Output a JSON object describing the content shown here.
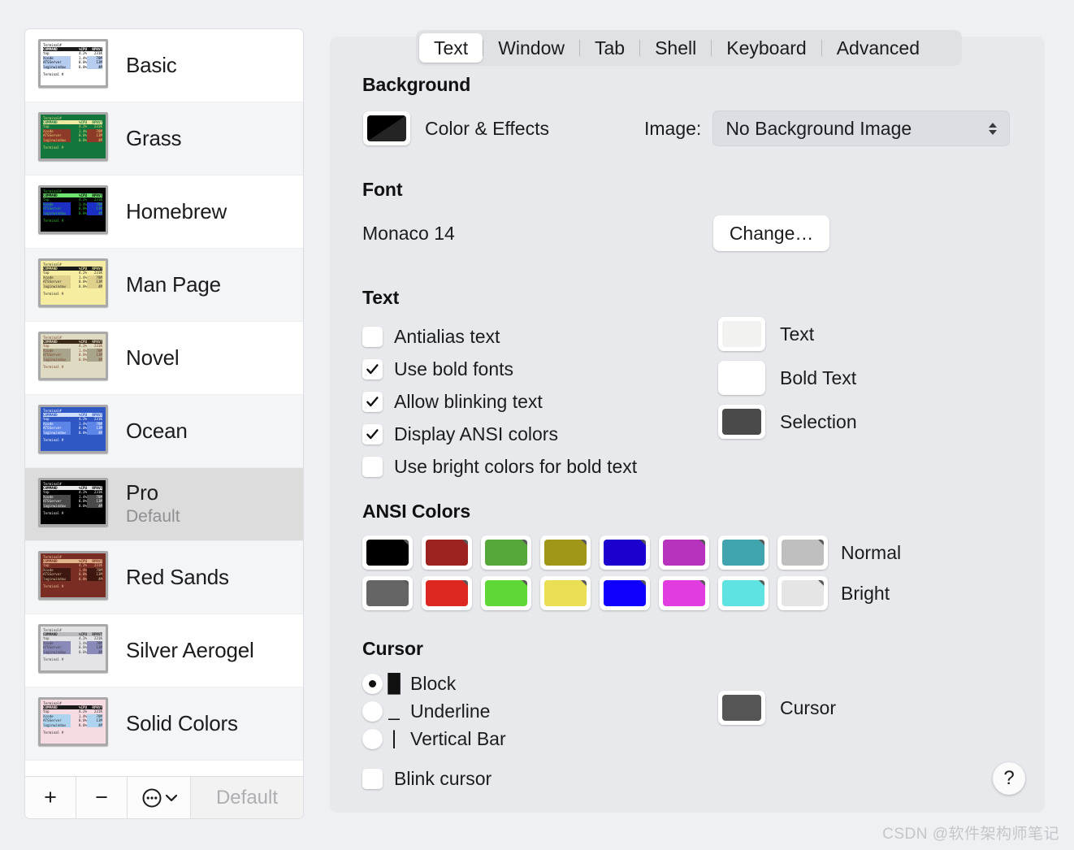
{
  "window": {
    "watermark": "CSDN @软件架构师笔记",
    "help_label": "?"
  },
  "tabs": [
    {
      "label": "Text",
      "active": true
    },
    {
      "label": "Window",
      "active": false
    },
    {
      "label": "Tab",
      "active": false
    },
    {
      "label": "Shell",
      "active": false
    },
    {
      "label": "Keyboard",
      "active": false
    },
    {
      "label": "Advanced",
      "active": false
    }
  ],
  "sidebar": {
    "profiles": [
      {
        "name": "Basic",
        "subtitle": "",
        "selected": false,
        "theme": {
          "bg": "#ffffff",
          "fg": "#000000",
          "hdr_bg": "#1a1a1a",
          "hdr_fg": "#ffffff",
          "sel": "#b6cdf0",
          "prompt": "#000000"
        }
      },
      {
        "name": "Grass",
        "subtitle": "",
        "selected": false,
        "theme": {
          "bg": "#13773d",
          "fg": "#e8d77a",
          "hdr_bg": "#efe8a0",
          "hdr_fg": "#13773d",
          "sel": "#8d3a28",
          "prompt": "#e8d77a"
        }
      },
      {
        "name": "Homebrew",
        "subtitle": "",
        "selected": false,
        "theme": {
          "bg": "#000000",
          "fg": "#35c035",
          "hdr_bg": "#6ee26e",
          "hdr_fg": "#000000",
          "sel": "#1b2fc4",
          "prompt": "#35c035"
        }
      },
      {
        "name": "Man Page",
        "subtitle": "",
        "selected": false,
        "theme": {
          "bg": "#f7eda0",
          "fg": "#2a2a2a",
          "hdr_bg": "#1a1a1a",
          "hdr_fg": "#f7eda0",
          "sel": "#ded08a",
          "prompt": "#2a2a2a"
        }
      },
      {
        "name": "Novel",
        "subtitle": "",
        "selected": false,
        "theme": {
          "bg": "#dfdbc3",
          "fg": "#7a3b22",
          "hdr_bg": "#3b2a18",
          "hdr_fg": "#dfdbc3",
          "sel": "#a9a58c",
          "prompt": "#7a3b22"
        }
      },
      {
        "name": "Ocean",
        "subtitle": "",
        "selected": false,
        "theme": {
          "bg": "#2f58c4",
          "fg": "#ffffff",
          "hdr_bg": "#cfe0ff",
          "hdr_fg": "#2f58c4",
          "sel": "#5d85e8",
          "prompt": "#ffffff"
        }
      },
      {
        "name": "Pro",
        "subtitle": "Default",
        "selected": true,
        "theme": {
          "bg": "#000000",
          "fg": "#f2f2f0",
          "hdr_bg": "#e8e8e6",
          "hdr_fg": "#000000",
          "sel": "#4a4a4a",
          "prompt": "#f2f2f0"
        }
      },
      {
        "name": "Red Sands",
        "subtitle": "",
        "selected": false,
        "theme": {
          "bg": "#7a2d22",
          "fg": "#e8c9a0",
          "hdr_bg": "#e0b38a",
          "hdr_fg": "#7a2d22",
          "sel": "#3d1710",
          "prompt": "#e8c9a0"
        }
      },
      {
        "name": "Silver Aerogel",
        "subtitle": "",
        "selected": false,
        "theme": {
          "bg": "#e4e4e6",
          "fg": "#3a3a3c",
          "hdr_bg": "#b9b9bd",
          "hdr_fg": "#2a2a2c",
          "sel": "#8a8ab8",
          "prompt": "#3a3a3c"
        }
      },
      {
        "name": "Solid Colors",
        "subtitle": "",
        "selected": false,
        "theme": {
          "bg": "#f6dbe2",
          "fg": "#2a2a2a",
          "hdr_bg": "#1a1a1a",
          "hdr_fg": "#f6dbe2",
          "sel": "#add3ef",
          "prompt": "#2a2a2a"
        }
      }
    ],
    "thumbnail_text": {
      "title": "Terminal#",
      "header": {
        "command": "COMMAND",
        "cpu": "%CPU",
        "rprvt": "RPRVT"
      },
      "rows": [
        {
          "command": "top",
          "cpu": "4.2%",
          "rprvt": "231K"
        },
        {
          "command": "Xcode",
          "cpu": "1.4%",
          "rprvt": "78M"
        },
        {
          "command": "ATSServer",
          "cpu": "0.0%",
          "rprvt": "13M"
        },
        {
          "command": "loginwindow",
          "cpu": "0.0%",
          "rprvt": "4M"
        }
      ],
      "prompt": "Terminal #"
    },
    "toolbar": {
      "add_label": "+",
      "remove_label": "−",
      "actions_label": "⋯",
      "default_label": "Default"
    }
  },
  "background_section": {
    "title": "Background",
    "color_effects_label": "Color & Effects",
    "color_swatch": {
      "top": "#000000",
      "bottom": "#242424"
    },
    "image_label": "Image:",
    "image_value": "No Background Image"
  },
  "font_section": {
    "title": "Font",
    "value": "Monaco 14",
    "change_label": "Change…"
  },
  "text_section": {
    "title": "Text",
    "checkboxes": [
      {
        "label": "Antialias text",
        "checked": false
      },
      {
        "label": "Use bold fonts",
        "checked": true
      },
      {
        "label": "Allow blinking text",
        "checked": true
      },
      {
        "label": "Display ANSI colors",
        "checked": true
      },
      {
        "label": "Use bright colors for bold text",
        "checked": false
      }
    ],
    "color_wells": [
      {
        "label": "Text",
        "color": "#f2f2f0"
      },
      {
        "label": "Bold Text",
        "color": "#ffffff"
      },
      {
        "label": "Selection",
        "color": "#4a4a4a"
      }
    ]
  },
  "ansi_section": {
    "title": "ANSI Colors",
    "normal_label": "Normal",
    "bright_label": "Bright",
    "normal": [
      "#000000",
      "#9c2220",
      "#56a63a",
      "#a09618",
      "#1c00ce",
      "#b732bd",
      "#40a5ae",
      "#bfbfbf"
    ],
    "bright": [
      "#656565",
      "#dc2821",
      "#5fd837",
      "#eade55",
      "#0f00fd",
      "#e03ce0",
      "#5ee2e2",
      "#e5e5e5"
    ]
  },
  "cursor_section": {
    "title": "Cursor",
    "options": [
      {
        "label": "Block",
        "glyph": "█",
        "selected": true
      },
      {
        "label": "Underline",
        "glyph": "_",
        "selected": false
      },
      {
        "label": "Vertical Bar",
        "glyph": "|",
        "selected": false
      }
    ],
    "blink": {
      "label": "Blink cursor",
      "checked": false
    },
    "color_well": {
      "label": "Cursor",
      "color": "#555555"
    }
  }
}
